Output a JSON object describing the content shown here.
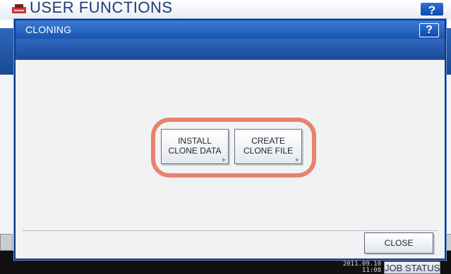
{
  "background": {
    "title": "USER FUNCTIONS",
    "help_label": "?",
    "clock_line1": "2011.09.10",
    "clock_line2": "11:08",
    "job_status_label": "JOB STATUS",
    "logo_icon": "printer-icon"
  },
  "dialog": {
    "title": "CLONING",
    "help_label": "?",
    "options": [
      {
        "label": "INSTALL\nCLONE DATA",
        "icon": "arrow-right-icon"
      },
      {
        "label": "CREATE\nCLONE FILE",
        "icon": "arrow-right-icon"
      }
    ],
    "close_label": "CLOSE"
  },
  "colors": {
    "titlebar_blue": "#1a55b0",
    "highlight_ring": "#e8826c",
    "dialog_border": "#0a3a86"
  }
}
